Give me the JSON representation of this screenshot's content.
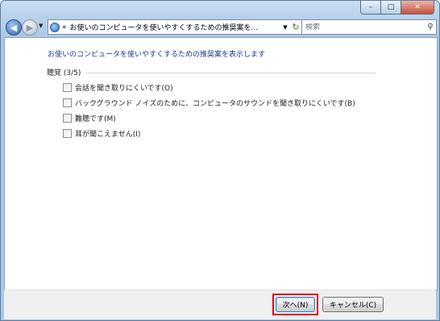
{
  "window": {
    "controls": {
      "minimize": "–",
      "maximize": "□",
      "close": "✕"
    }
  },
  "nav": {
    "back_icon": "arrow-left-icon",
    "forward_icon": "arrow-right-icon",
    "address": {
      "chevron": "«",
      "path": "お使いのコンピュータを使いやすくするための推奨案を..."
    },
    "search": {
      "placeholder": "検索"
    }
  },
  "content": {
    "heading": "お使いのコンピュータを使いやすくするための推奨案を表示します",
    "group_label": "聴覚 (3/5)",
    "options": [
      {
        "label": "会話を聞き取りにくいです(O)",
        "checked": false
      },
      {
        "label": "バックグラウンド ノイズのために、コンピュータのサウンドを聞き取りにくいです(B)",
        "checked": false
      },
      {
        "label": "難聴です(M)",
        "checked": false
      },
      {
        "label": "耳が聞こえません(I)",
        "checked": false
      }
    ]
  },
  "footer": {
    "next_label": "次へ(N)",
    "cancel_label": "キャンセル(C)"
  },
  "colors": {
    "heading": "#1e3a8a",
    "highlight_border": "#e0001c",
    "frame": "#b9d3ec"
  }
}
